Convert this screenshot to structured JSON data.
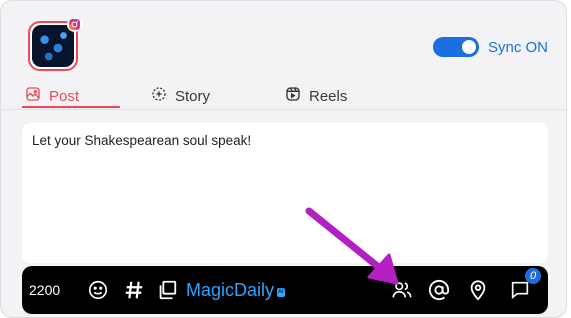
{
  "profile": {
    "platform_icon": "instagram-icon"
  },
  "sync": {
    "label": "Sync ON",
    "enabled": true,
    "color": "#1b6fe0"
  },
  "tabs": [
    {
      "label": "Post",
      "icon": "image-icon",
      "active": true
    },
    {
      "label": "Story",
      "icon": "story-plus-icon",
      "active": false
    },
    {
      "label": "Reels",
      "icon": "reels-icon",
      "active": false
    }
  ],
  "editor": {
    "text": "Let your Shakespearean soul speak!"
  },
  "toolbar": {
    "char_count": "2200",
    "brand": "MagicDaily",
    "brand_badge": "AI",
    "comment_count": "0",
    "icons": [
      "emoji-icon",
      "hashtag-icon",
      "copy-icon",
      "tag-people-icon",
      "mention-icon",
      "location-pin-icon",
      "comment-icon"
    ]
  },
  "colors": {
    "accent_red": "#e94b57",
    "accent_blue": "#1e6ee0",
    "arrow": "#b41fc4"
  }
}
